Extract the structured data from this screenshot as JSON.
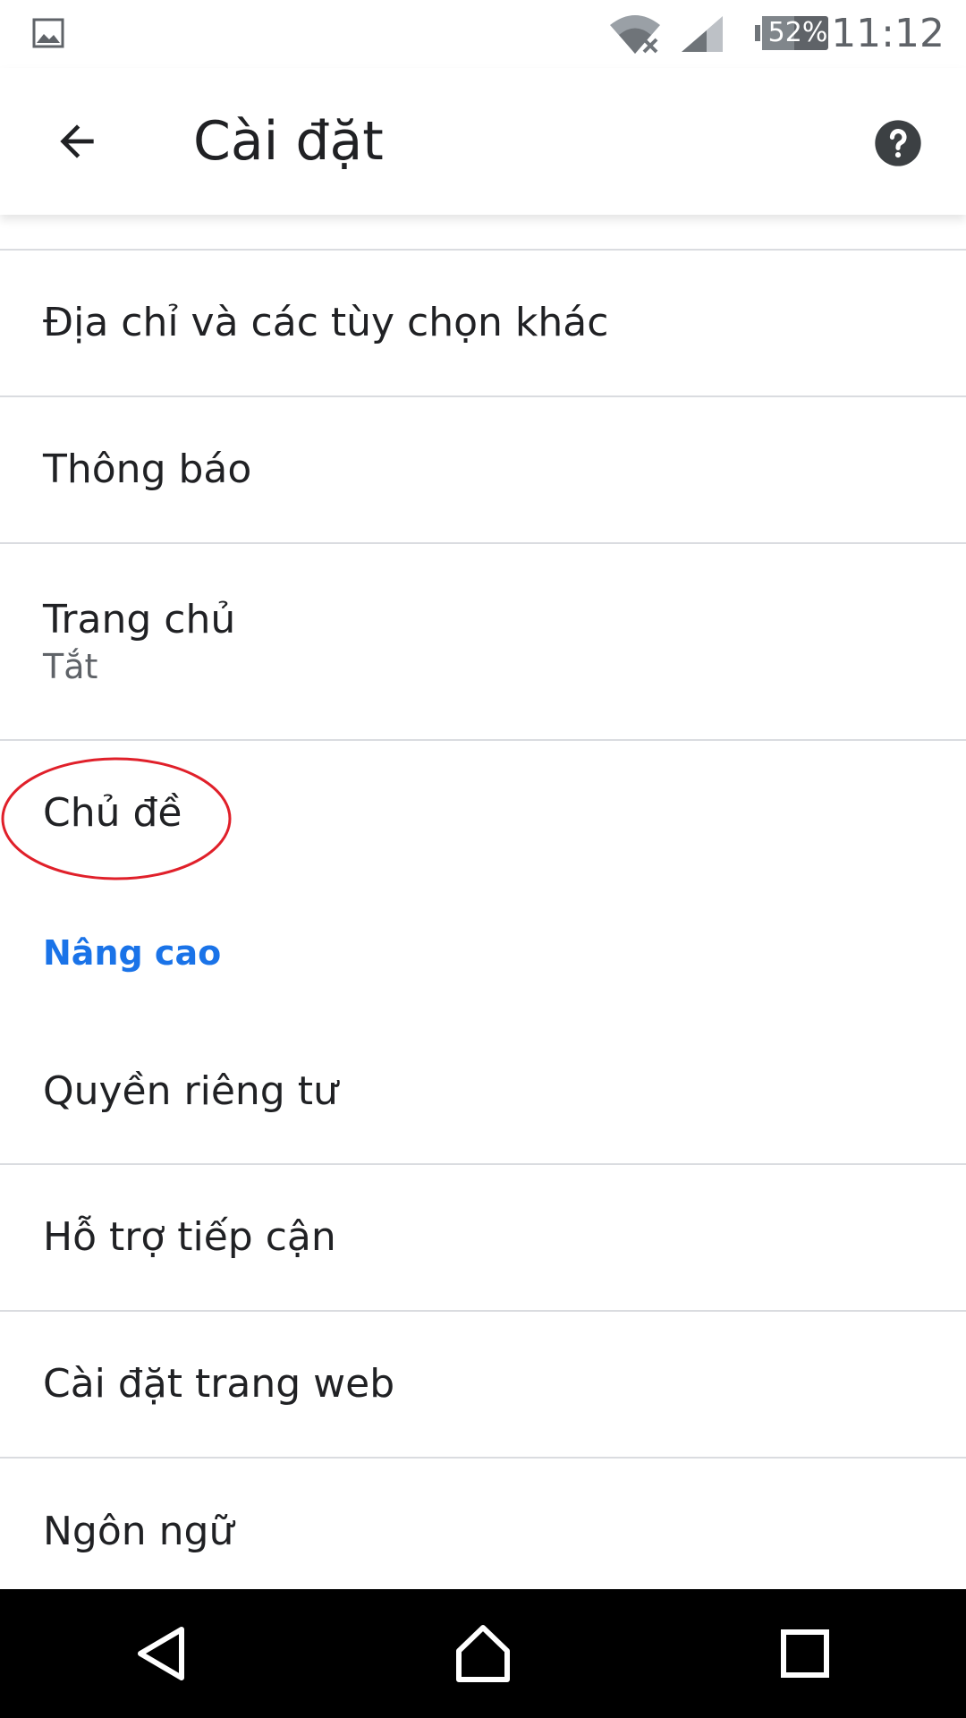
{
  "status_bar": {
    "battery_level": "52%",
    "time": "11:12",
    "icons": [
      "gallery-icon",
      "wifi-icon",
      "signal-icon",
      "battery-icon"
    ]
  },
  "app_bar": {
    "title": "Cài đặt",
    "back_icon": "arrow-left-icon",
    "help_icon": "help-circle-icon"
  },
  "list": {
    "items_top": [
      {
        "label": "Địa chỉ và các tùy chọn khác"
      },
      {
        "label": "Thông báo"
      },
      {
        "label": "Trang chủ",
        "sub": "Tắt"
      },
      {
        "label": "Chủ đề"
      }
    ],
    "section_header": "Nâng cao",
    "items_bottom": [
      {
        "label": "Quyền riêng tư"
      },
      {
        "label": "Hỗ trợ tiếp cận"
      },
      {
        "label": "Cài đặt trang web"
      },
      {
        "label": "Ngôn ngữ"
      }
    ]
  },
  "colors": {
    "accent": "#1a73e8",
    "annotation": "#e0202a",
    "text_primary": "#202124",
    "text_secondary": "#5f6368",
    "divider": "#dadce0"
  },
  "nav_bar": {
    "icons": [
      "back-triangle-icon",
      "home-icon",
      "recents-square-icon"
    ]
  }
}
